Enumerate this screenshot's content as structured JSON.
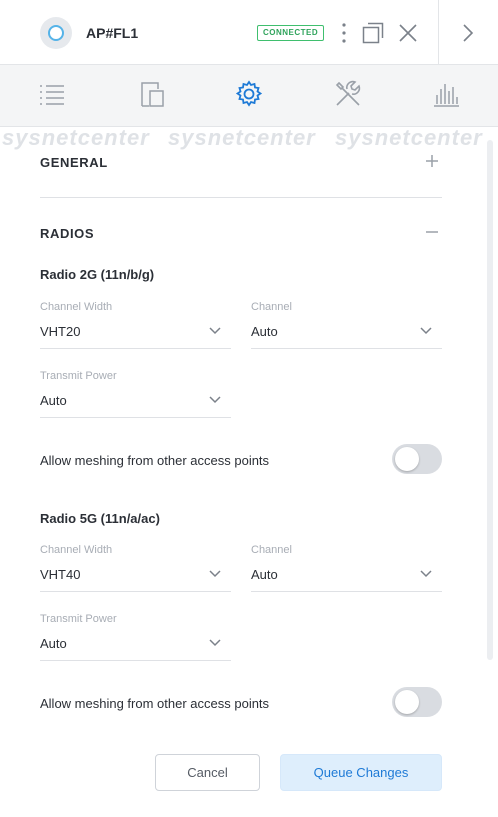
{
  "header": {
    "device_name": "AP#FL1",
    "status_badge": "CONNECTED",
    "icons": [
      "device-icon",
      "more-options-icon",
      "pop-out-icon",
      "close-icon",
      "chevron-right-icon"
    ]
  },
  "tabs": [
    {
      "name": "details",
      "icon": "list-icon",
      "active": false
    },
    {
      "name": "devices",
      "icon": "devices-icon",
      "active": false
    },
    {
      "name": "configuration",
      "icon": "gear-icon",
      "active": true
    },
    {
      "name": "tools",
      "icon": "tools-icon",
      "active": false
    },
    {
      "name": "statistics",
      "icon": "bar-chart-icon",
      "active": false
    }
  ],
  "watermark": [
    "sysnetcenter",
    "sysnetcenter",
    "sysnetcenter"
  ],
  "general": {
    "title": "GENERAL",
    "toggle_symbol": "+"
  },
  "radios": {
    "title": "RADIOS",
    "toggle_symbol": "−",
    "radio_2g": {
      "title": "Radio 2G (11n/b/g)",
      "channel_width_label": "Channel Width",
      "channel_width_value": "VHT20",
      "channel_label": "Channel",
      "channel_value": "Auto",
      "transmit_power_label": "Transmit Power",
      "transmit_power_value": "Auto",
      "meshing_label": "Allow meshing from other access points",
      "meshing_enabled": false
    },
    "radio_5g": {
      "title": "Radio 5G (11n/a/ac)",
      "channel_width_label": "Channel Width",
      "channel_width_value": "VHT40",
      "channel_label": "Channel",
      "channel_value": "Auto",
      "transmit_power_label": "Transmit Power",
      "transmit_power_value": "Auto",
      "meshing_label": "Allow meshing from other access points",
      "meshing_enabled": false
    }
  },
  "actions": {
    "cancel_label": "Cancel",
    "queue_label": "Queue Changes"
  },
  "colors": {
    "accent": "#1e7ad6",
    "connected": "#2fa35b",
    "queue_bg": "#deeefc"
  }
}
